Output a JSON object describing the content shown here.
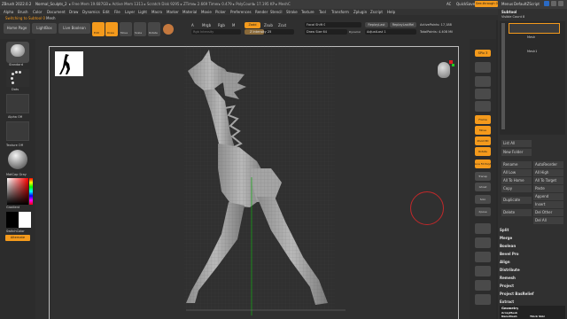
{
  "titlebar": {
    "app": "ZBrush 2022.0.2",
    "doc": "Normal_Sculpts_2",
    "stats": "▸ Free Mem 19.687GB ▸ Active Mem 1311 ▸ Scratch Disk 9295 ▸ ZTime▸ 2.669 Timer▸ 0.479 ▸ PolyCount▸ 17.195 KP ▸ MeshCount▸ 1",
    "ac": "AC",
    "quicksave": "QuickSave",
    "seethrough": "See-through 0",
    "menus": "Menus",
    "defaultscript": "DefaultZScript"
  },
  "menubar": [
    "Alpha",
    "Brush",
    "Color",
    "Document",
    "Draw",
    "Dynamics",
    "Edit",
    "File",
    "Layer",
    "Light",
    "Macro",
    "Marker",
    "Material",
    "Movie",
    "Picker",
    "Preferences",
    "Render",
    "Stencil",
    "Stroke",
    "Texture",
    "Tool",
    "Transform",
    "Zplugin",
    "Zscript",
    "Help"
  ],
  "status": {
    "left": "Switching to Subtool 0",
    "mesh": "Mesh"
  },
  "toptool": {
    "homepage": "Home Page",
    "lightbox": "LightBox",
    "liveboolean": "Live Boolean",
    "edit": "Edit",
    "draw": "Draw",
    "move": "Move",
    "scale": "Scale",
    "rotate": "Rotate",
    "a": "A",
    "mrgb": "Mrgb",
    "rgb": "Rgb",
    "m": "M",
    "zadd": "Zadd",
    "zsub": "Zsub",
    "zcut": "Zcut",
    "rgb_intensity": "Rgb Intensity",
    "z_intensity": "Z Intensity 25",
    "focal_shift": "Focal Shift 0",
    "draw_size": "Draw Size 64",
    "dynamic": "Dynamic",
    "replaylast": "ReplayLast",
    "replaylastrel": "ReplayLastRel",
    "adjustlast": "AdjustLast 1",
    "active_points": "ActivePoints: 17,188",
    "total_points": "TotalPoints: 4.408 Mil"
  },
  "left": {
    "standard": "Standard",
    "dots": "Dots",
    "alpha_off": "Alpha Off",
    "texture_off": "Texture Off",
    "matcap": "MatCap Gray",
    "gradient": "Gradient",
    "switchcolor": "SwitchColor",
    "alternate": "Alternate"
  },
  "right_shelf": {
    "spix": "SPix 3",
    "items": [
      "Frame",
      "Move",
      "Zoom3D",
      "Rotate",
      "Line Fill PolyF",
      "Transp",
      "Ghost",
      "Solo",
      "Xpose"
    ]
  },
  "tray": {
    "title": "Subtool",
    "visible_count": "Visible Count 8",
    "subtools": [
      "Mesh",
      "Mesh1"
    ],
    "list_all": "List All",
    "new_folder": "New Folder",
    "rename": "Rename",
    "autoreorder": "AutoReorder",
    "all_low": "All Low",
    "all_high": "All High",
    "all_to_home": "All To Home",
    "all_to_target": "All To Target",
    "copy": "Copy",
    "paste": "Paste",
    "append": "Append",
    "duplicate": "Duplicate",
    "insert": "Insert",
    "delete": "Delete",
    "del_other": "Del Other",
    "del_all": "Del All",
    "sections": [
      "Split",
      "Merge",
      "Boolean",
      "Bevel Pro",
      "Align",
      "Distribute",
      "Remesh",
      "Project",
      "Project BasRelief",
      "Extract"
    ],
    "bottom": [
      "Geometry",
      "ArrayMesh",
      "NanoMesh",
      "Thick Skin"
    ]
  },
  "colors": {
    "accent": "#f49a1c",
    "bg": "#2f2f2f",
    "panel": "#3f3f3f"
  }
}
